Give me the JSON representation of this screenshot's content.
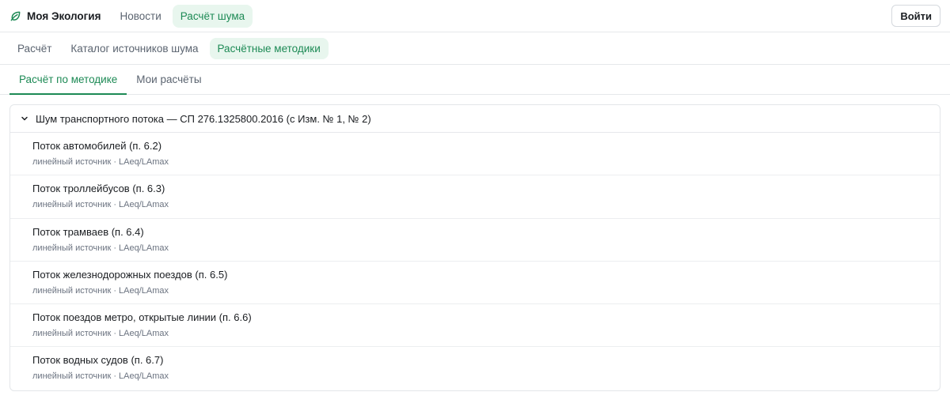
{
  "header": {
    "brand": {
      "icon": "leaf-icon",
      "label": "Моя Экология",
      "accent": "#1d8a55"
    },
    "nav": [
      {
        "label": "Новости",
        "active": false
      },
      {
        "label": "Расчёт шума",
        "active": true
      }
    ],
    "login_label": "Войти"
  },
  "subnav": [
    {
      "label": "Расчёт",
      "active": false
    },
    {
      "label": "Каталог источников шума",
      "active": false
    },
    {
      "label": "Расчётные методики",
      "active": true
    }
  ],
  "tabs": [
    {
      "label": "Расчёт по методике",
      "active": true
    },
    {
      "label": "Мои расчёты",
      "active": false
    }
  ],
  "group": {
    "icon": "chevron-down-icon",
    "title": "Шум транспортного потока — СП 276.1325800.2016 (с Изм. № 1, № 2)",
    "items": [
      {
        "title": "Поток автомобилей (п. 6.2)",
        "meta": "линейный источник · LAeq/LAmax"
      },
      {
        "title": "Поток троллейбусов (п. 6.3)",
        "meta": "линейный источник · LAeq/LAmax"
      },
      {
        "title": "Поток трамваев (п. 6.4)",
        "meta": "линейный источник · LAeq/LAmax"
      },
      {
        "title": "Поток железнодорожных поездов (п. 6.5)",
        "meta": "линейный источник · LAeq/LAmax"
      },
      {
        "title": "Поток поездов метро, открытые линии (п. 6.6)",
        "meta": "линейный источник · LAeq/LAmax"
      },
      {
        "title": "Поток водных судов (п. 6.7)",
        "meta": "линейный источник · LAeq/LAmax"
      }
    ]
  }
}
